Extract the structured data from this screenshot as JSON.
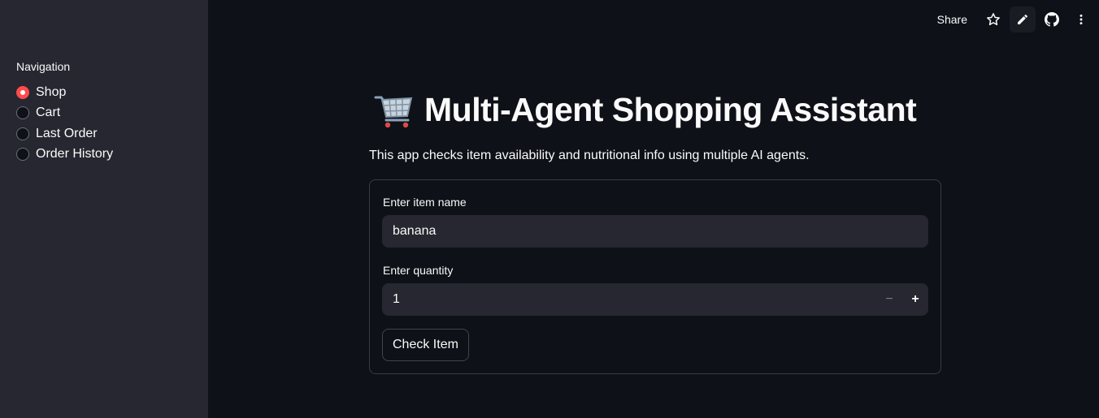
{
  "sidebar": {
    "nav_title": "Navigation",
    "items": [
      {
        "label": "Shop",
        "selected": true
      },
      {
        "label": "Cart",
        "selected": false
      },
      {
        "label": "Last Order",
        "selected": false
      },
      {
        "label": "Order History",
        "selected": false
      }
    ]
  },
  "toolbar": {
    "share_label": "Share",
    "icons": [
      "star-icon",
      "pencil-icon",
      "github-icon",
      "more-vertical-icon"
    ]
  },
  "main": {
    "title_icon": "shopping-cart-icon",
    "title": "Multi-Agent Shopping Assistant",
    "subtitle": "This app checks item availability and nutritional info using multiple AI agents.",
    "form": {
      "item_label": "Enter item name",
      "item_value": "banana",
      "quantity_label": "Enter quantity",
      "quantity_value": "1",
      "minus_label": "−",
      "plus_label": "+",
      "submit_label": "Check Item"
    }
  },
  "colors": {
    "background": "#0e1117",
    "sidebar": "#262730",
    "accent": "#ff4b4b",
    "input": "#262730",
    "text": "#fafafa"
  }
}
